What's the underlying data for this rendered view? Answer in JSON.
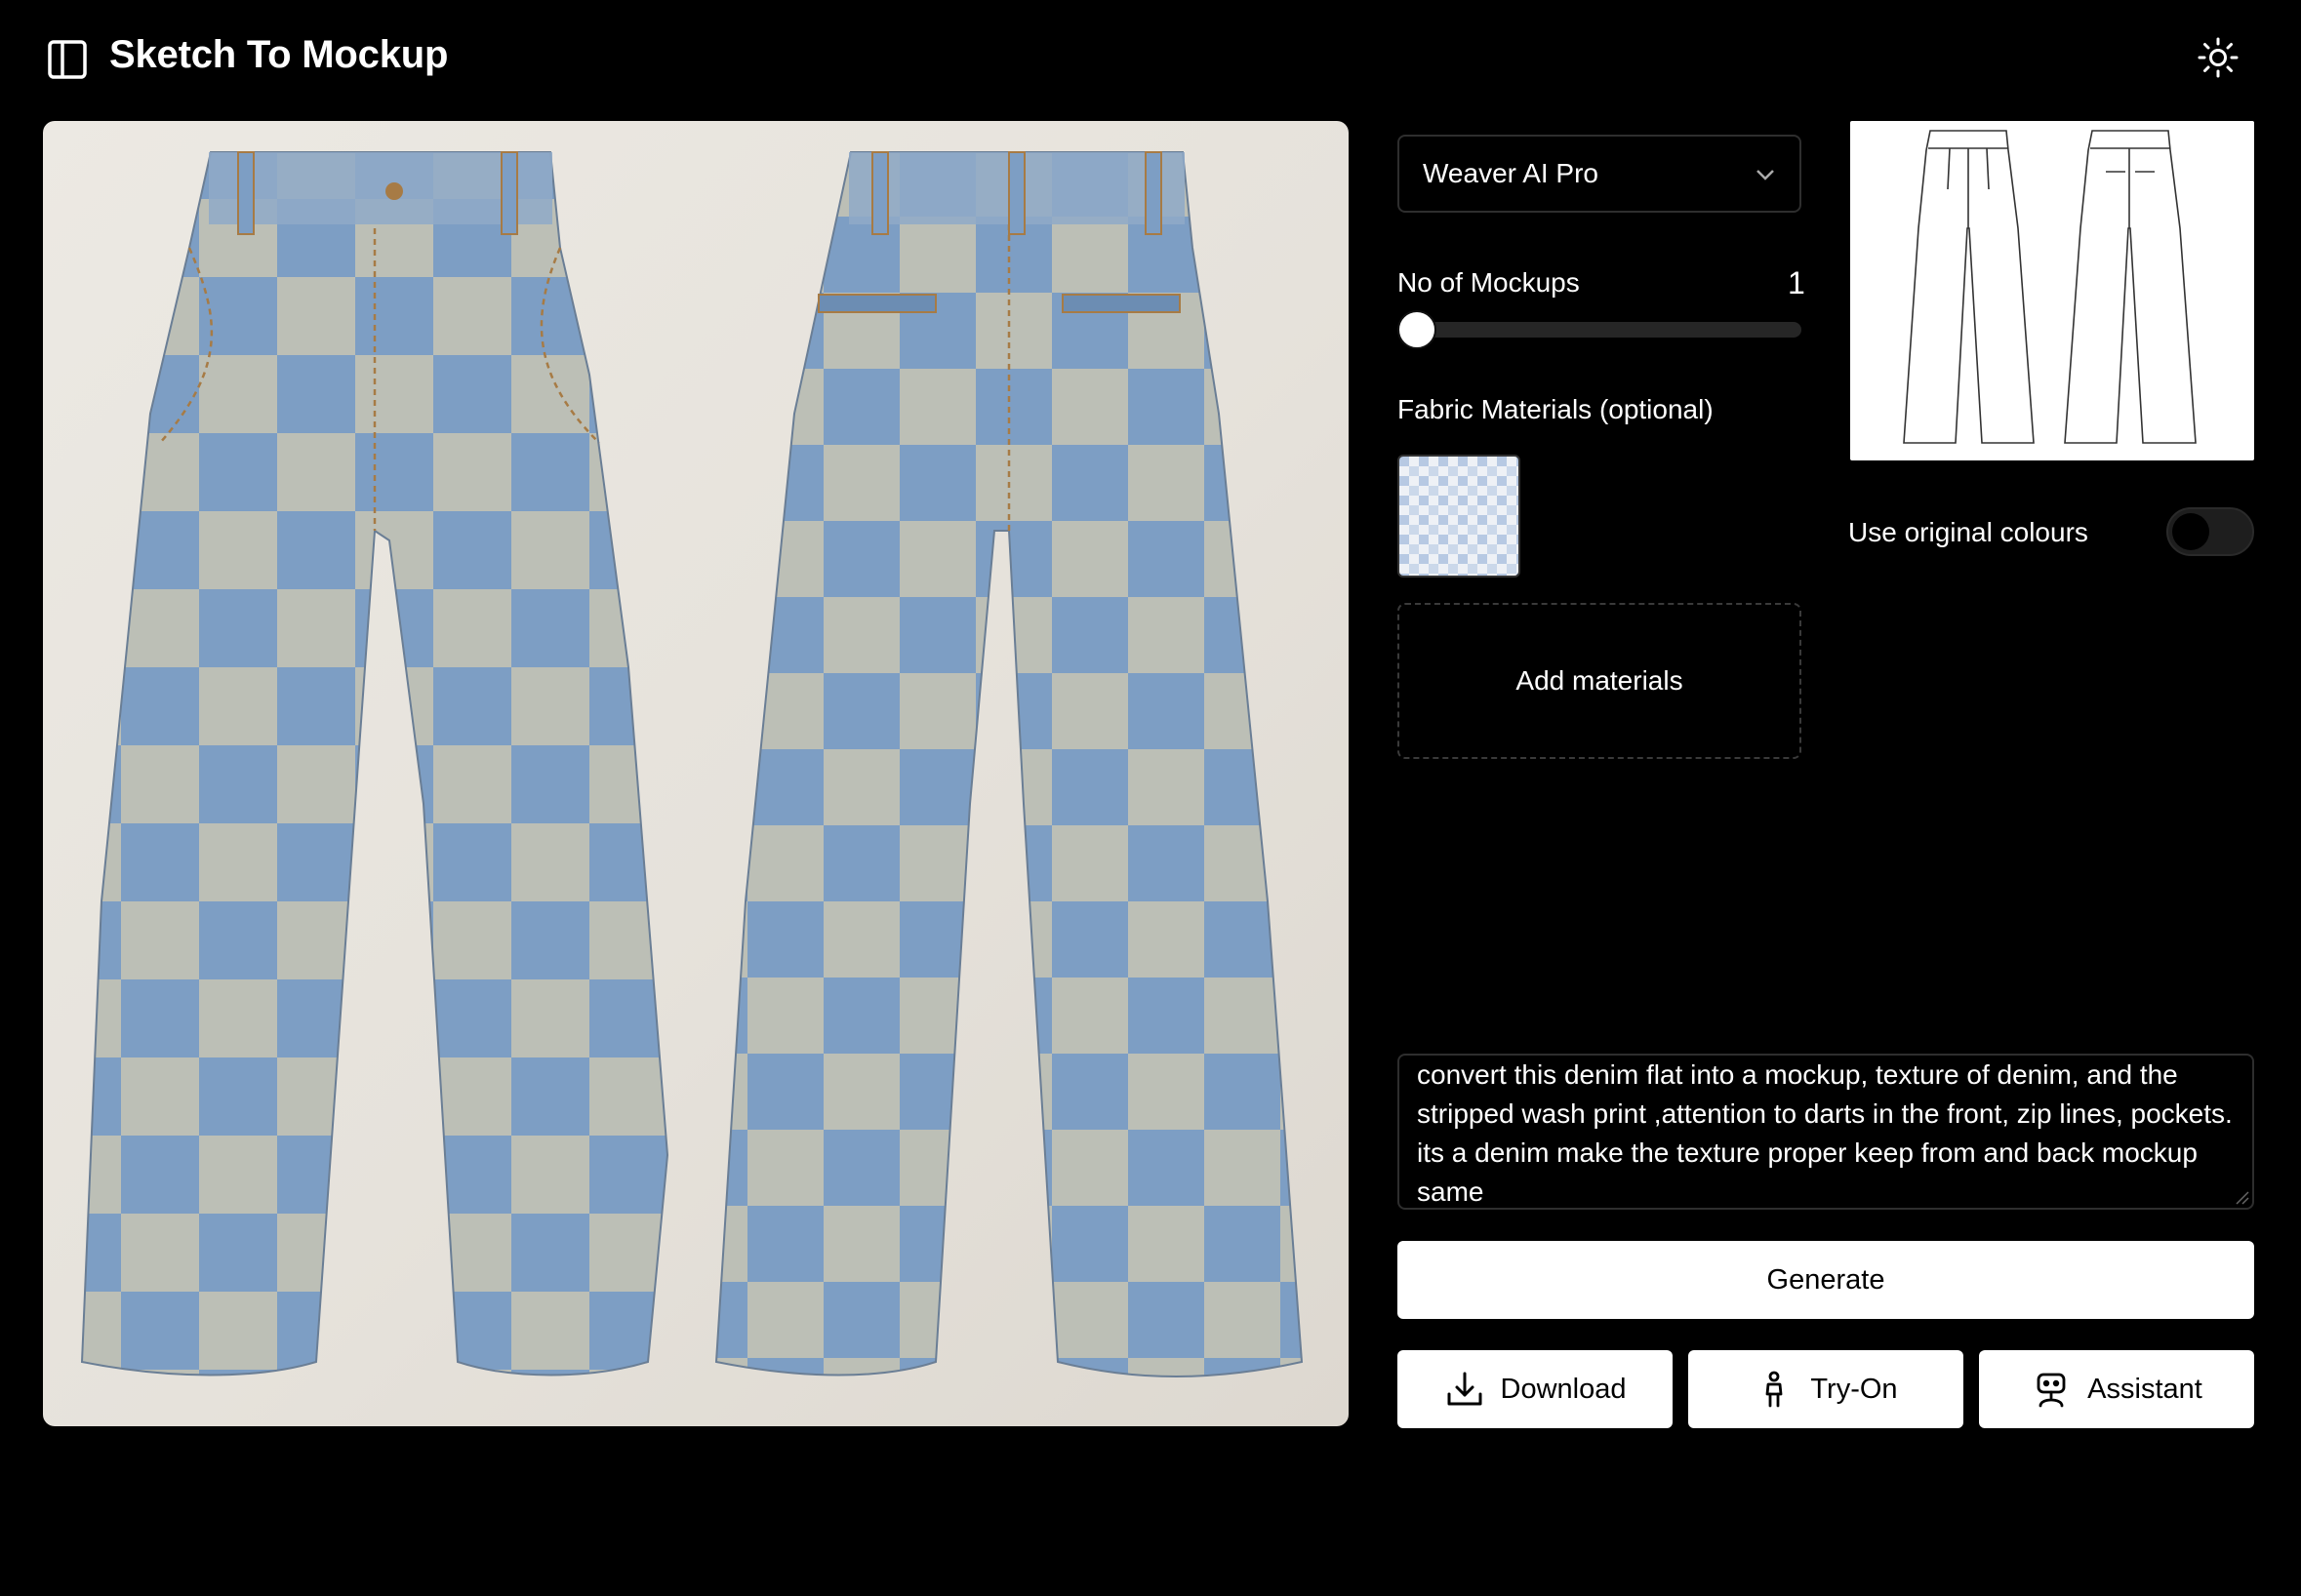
{
  "header": {
    "title": "Sketch To Mockup",
    "sidebar_icon": "sidebar-panel-icon",
    "theme_icon": "sun-icon"
  },
  "mockup": {
    "fabric_colors": {
      "blue": "#7d9ec4",
      "light": "#bcbfb6",
      "stitch": "#a77b45"
    }
  },
  "controls": {
    "model_selected": "Weaver AI Pro",
    "mockups_label": "No of Mockups",
    "mockups_value": "1",
    "mockups_fraction": 0.0,
    "fabric_label": "Fabric Materials (optional)",
    "add_materials_label": "Add materials",
    "original_colours_label": "Use original colours",
    "original_colours_on": false
  },
  "prompt": {
    "text": "convert this denim flat into a mockup, texture of denim, and the stripped wash print ,attention to darts in the front, zip lines, pockets. its a denim make the texture proper keep from and back mockup same"
  },
  "actions": {
    "generate_label": "Generate",
    "download_label": "Download",
    "tryon_label": "Try-On",
    "assistant_label": "Assistant"
  }
}
